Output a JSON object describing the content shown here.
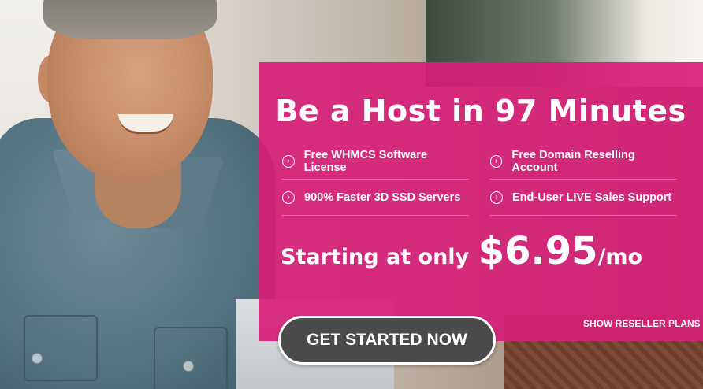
{
  "hero": {
    "headline": "Be a Host in 97 Minutes",
    "features": [
      {
        "label": "Free WHMCS Software License",
        "icon": "chevron-right-circle-icon"
      },
      {
        "label": "Free Domain Reselling Account",
        "icon": "chevron-right-circle-icon"
      },
      {
        "label": "900% Faster 3D SSD Servers",
        "icon": "chevron-right-circle-icon"
      },
      {
        "label": "End-User LIVE Sales Support",
        "icon": "chevron-right-circle-icon"
      }
    ],
    "price": {
      "prefix": "Starting at only",
      "amount": "$6.95",
      "suffix": "/mo"
    },
    "cta_label": "GET STARTED NOW",
    "secondary_link": "SHOW RESELLER PLANS",
    "chevron_glyph": "›"
  },
  "colors": {
    "banner": "#d62078",
    "cta_background": "#4b4b4b",
    "text": "#ffffff"
  }
}
